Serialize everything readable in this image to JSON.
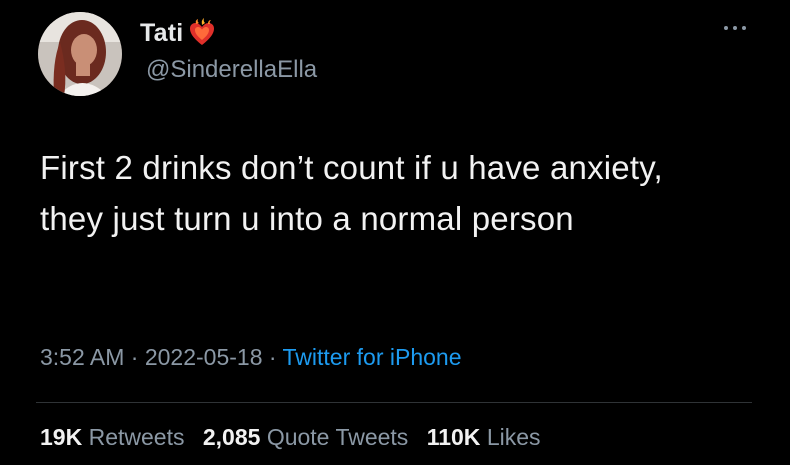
{
  "colors": {
    "background": "#000000",
    "primary_text": "#e7e9ea",
    "secondary_text": "#8b98a5",
    "link": "#1d9bf0",
    "divider": "#2f3336"
  },
  "author": {
    "display_name": "Tati",
    "handle": "@SinderellaElla",
    "badge_icon": "flaming-heart-icon",
    "avatar_icon": "avatar"
  },
  "menu": {
    "icon": "more-icon"
  },
  "tweet": {
    "text": "First 2 drinks don’t count if u have anxiety, they just turn u into a normal person"
  },
  "meta": {
    "time": "3:52 AM",
    "separator": " · ",
    "date": "2022-05-18",
    "source": "Twitter for iPhone"
  },
  "stats": {
    "retweets_count": "19K",
    "retweets_label": "Retweets",
    "quotes_count": "2,085",
    "quotes_label": "Quote Tweets",
    "likes_count": "110K",
    "likes_label": "Likes"
  }
}
